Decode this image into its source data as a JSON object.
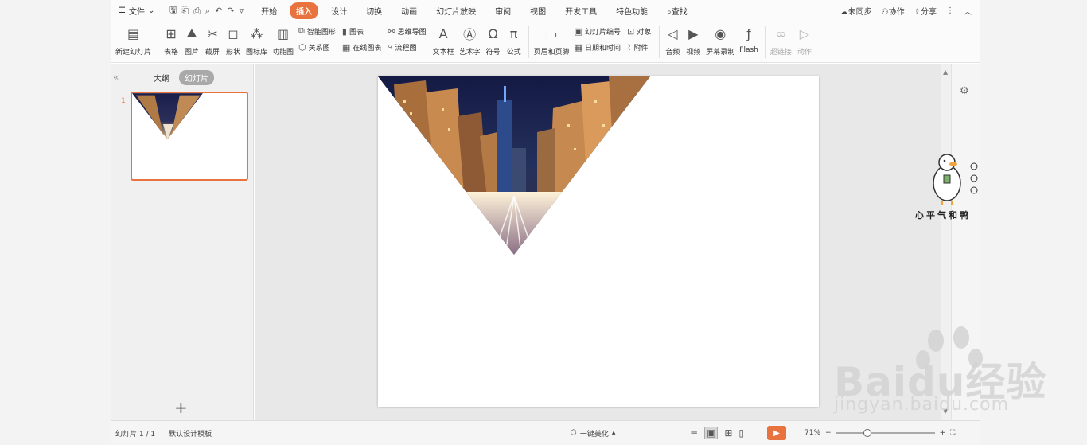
{
  "menubar": {
    "file_label": "文件",
    "tabs": [
      {
        "label": "开始"
      },
      {
        "label": "插入"
      },
      {
        "label": "设计"
      },
      {
        "label": "切换"
      },
      {
        "label": "动画"
      },
      {
        "label": "幻灯片放映"
      },
      {
        "label": "审阅"
      },
      {
        "label": "视图"
      },
      {
        "label": "开发工具"
      },
      {
        "label": "特色功能"
      }
    ],
    "search_label": "查找",
    "sync_label": "未同步",
    "collab_label": "协作",
    "share_label": "分享"
  },
  "ribbon": {
    "new_slide": "新建幻灯片",
    "table": "表格",
    "picture": "图片",
    "screenshot": "截屏",
    "shape": "形状",
    "icon_lib": "图标库",
    "func_chart": "功能图",
    "smart_art": "智能图形",
    "chart": "图表",
    "relation": "关系图",
    "online_chart": "在线图表",
    "mind_map": "思维导图",
    "flow_chart": "流程图",
    "textbox": "文本框",
    "word_art": "艺术字",
    "symbol": "符号",
    "formula": "公式",
    "header_footer": "页眉和页脚",
    "slide_number": "幻灯片编号",
    "date_time": "日期和时间",
    "object": "对象",
    "attachment": "附件",
    "audio": "音频",
    "video": "视频",
    "screen_record": "屏幕录制",
    "flash": "Flash",
    "hyperlink": "超链接",
    "action": "动作"
  },
  "left_panel": {
    "outline_tab": "大纲",
    "slides_tab": "幻灯片",
    "slide_number": "1",
    "add_symbol": "+"
  },
  "status": {
    "slide_info": "幻灯片 1 / 1",
    "template": "默认设计模板",
    "beautify": "一键美化",
    "zoom": "71%"
  },
  "watermark": {
    "mascot_caption": "心平气和鸭",
    "baidu": "Baidu经验",
    "baidu_url": "jingyan.baidu.com"
  },
  "colors": {
    "accent": "#e9733f"
  }
}
